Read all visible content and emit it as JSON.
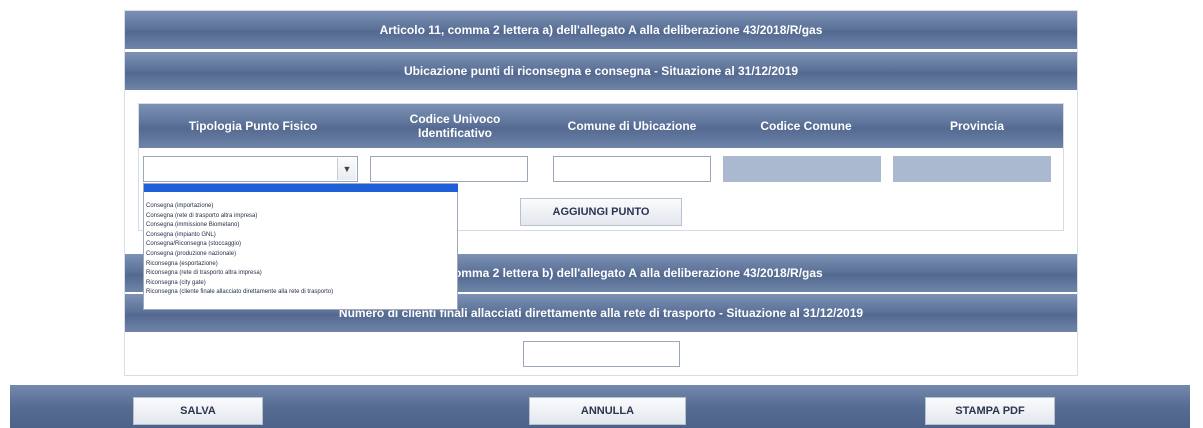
{
  "section_a": {
    "title": "Articolo 11, comma 2 lettera a) dell'allegato A alla deliberazione 43/2018/R/gas",
    "subtitle": "Ubicazione punti di riconsegna e consegna - Situazione al 31/12/2019",
    "columns": [
      "Tipologia Punto Fisico",
      "Codice Univoco Identificativo",
      "Comune di Ubicazione",
      "Codice Comune",
      "Provincia"
    ],
    "add_button": "AGGIUNGI PUNTO",
    "dropdown_options": [
      "Consegna (importazione)",
      "Consegna (rete di trasporto altra impresa)",
      "Consegna (immissione Biometano)",
      "Consegna (impianto GNL)",
      "Consegna/Riconsegna (stoccaggio)",
      "Consegna (produzione nazionale)",
      "Riconsegna (esportazione)",
      "Riconsegna (rete di trasporto altra impresa)",
      "Riconsegna (city gate)",
      "Riconsegna (cliente finale allacciato direttamente alla rete di trasporto)"
    ]
  },
  "section_b": {
    "title": "Articolo 11, comma 2 lettera b) dell'allegato A alla deliberazione 43/2018/R/gas",
    "subtitle": "Numero di clienti finali allacciati direttamente alla rete di trasporto - Situazione al 31/12/2019"
  },
  "footer": {
    "save": "SALVA",
    "cancel": "ANNULLA",
    "print": "STAMPA PDF"
  }
}
